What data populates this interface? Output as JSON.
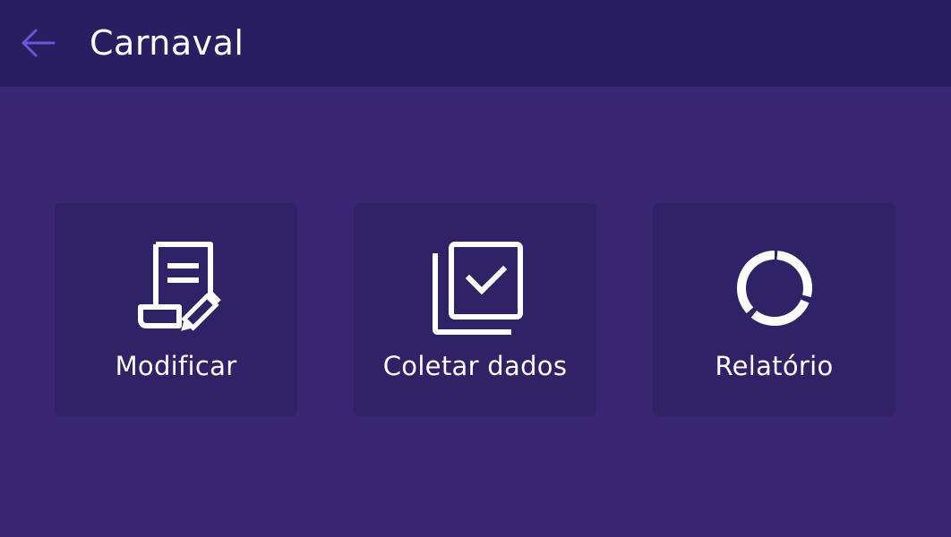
{
  "colors": {
    "background": "#382673",
    "header": "#2a1e63",
    "card": "#2f2266",
    "accent": "#6a55d6",
    "text": "#ffffff"
  },
  "header": {
    "back_icon": "arrow-left-icon",
    "title": "Carnaval"
  },
  "cards": [
    {
      "label": "Modificar",
      "icon": "document-edit-icon"
    },
    {
      "label": "Coletar dados",
      "icon": "checkbox-stack-icon"
    },
    {
      "label": "Relatório",
      "icon": "ring-chart-icon"
    }
  ]
}
